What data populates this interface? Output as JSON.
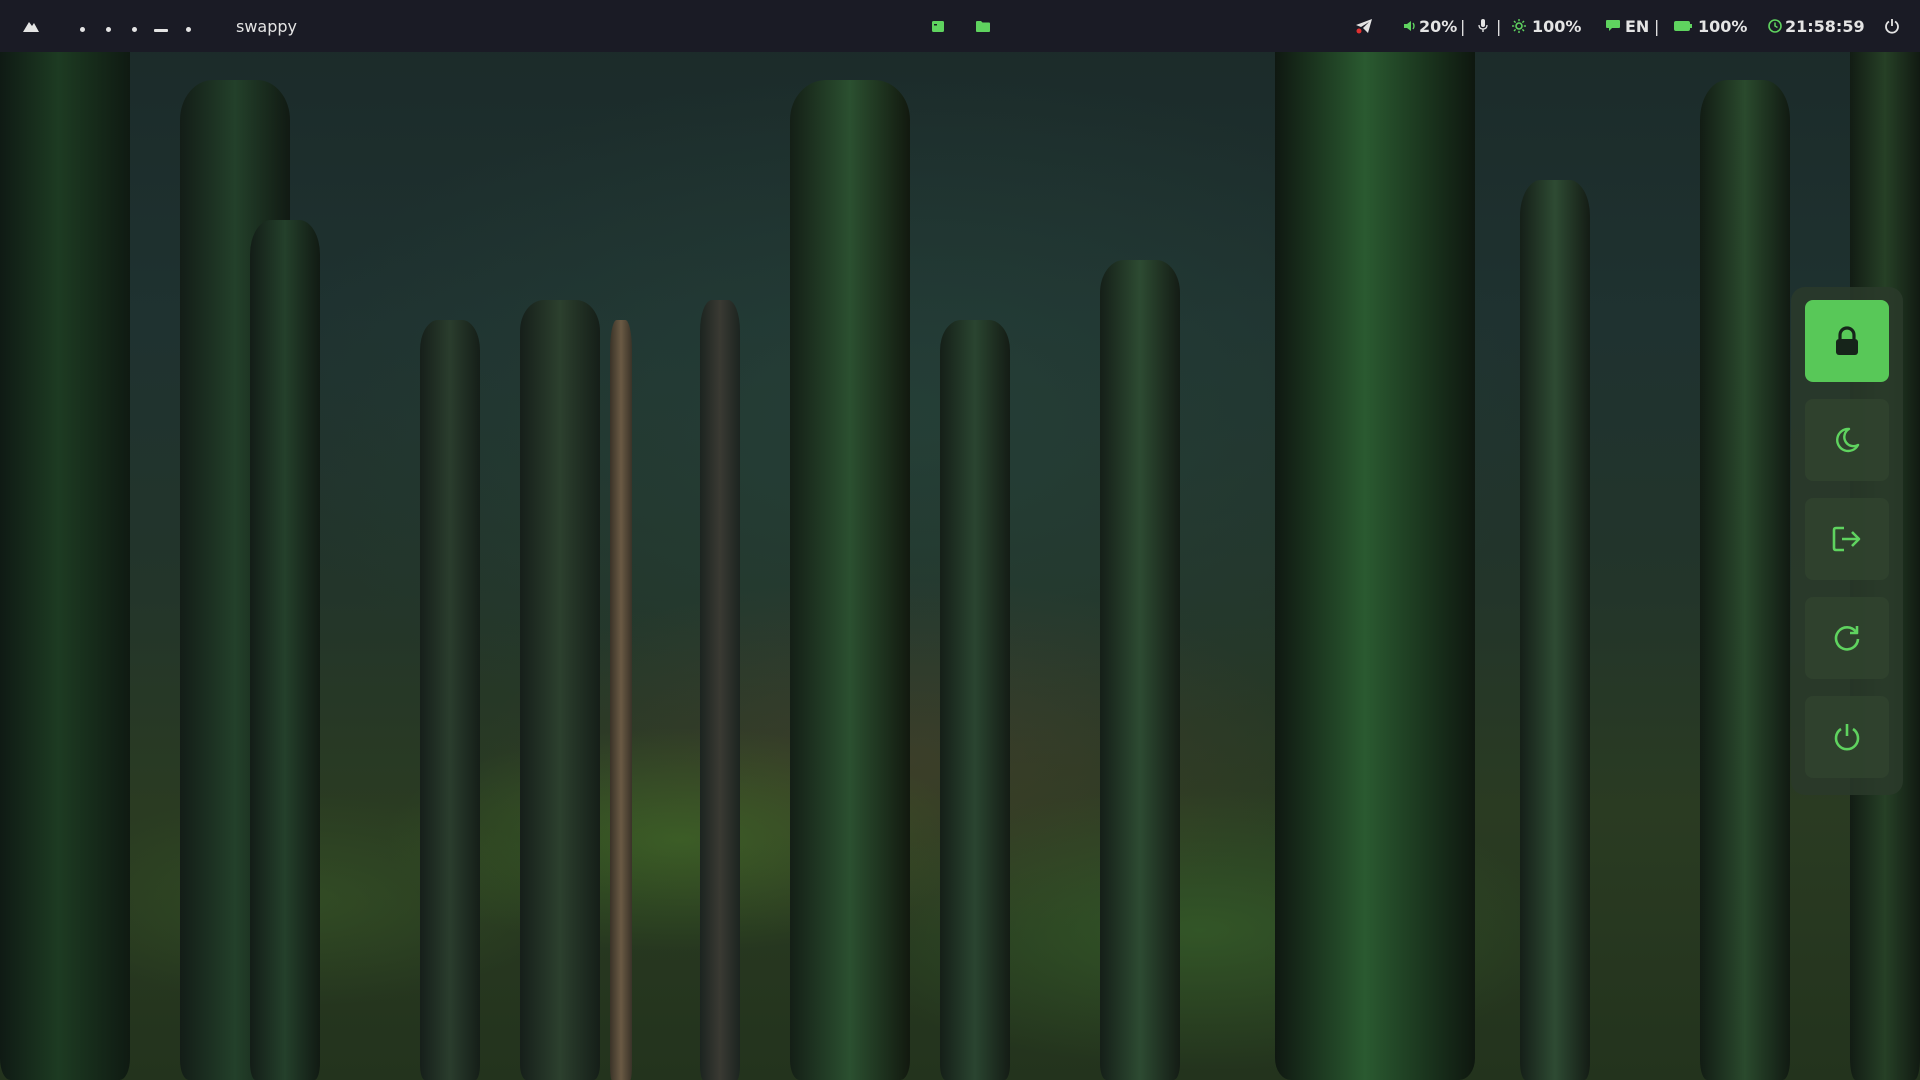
{
  "topbar": {
    "launcher_icon": "mountain-icon",
    "workspaces": [
      "dot",
      "dot",
      "dot",
      "dash",
      "dot"
    ],
    "window_title": "swappy",
    "center_icons": [
      "terminal-icon",
      "folder-icon"
    ],
    "tray_icon": "telegram-icon",
    "volume": {
      "icon": "volume-icon",
      "value": "20%"
    },
    "mic_icon": "microphone-icon",
    "brightness": {
      "icon": "sun-icon",
      "value": "100%"
    },
    "language": {
      "icon": "keyboard-icon",
      "value": "EN"
    },
    "battery": {
      "icon": "battery-icon",
      "value": "100%"
    },
    "clock": {
      "icon": "clock-icon",
      "value": "21:58:59"
    },
    "power_icon": "power-icon",
    "separator": "|"
  },
  "power_menu": {
    "buttons": [
      {
        "name": "lock",
        "icon": "lock-icon",
        "active": true
      },
      {
        "name": "suspend",
        "icon": "moon-icon",
        "active": false
      },
      {
        "name": "logout",
        "icon": "logout-icon",
        "active": false
      },
      {
        "name": "reboot",
        "icon": "reboot-icon",
        "active": false
      },
      {
        "name": "shutdown",
        "icon": "power-icon",
        "active": false
      }
    ]
  },
  "colors": {
    "bar_bg": "#1a1b25",
    "accent": "#5fd35f",
    "menu_bg": "#2a3a2a"
  }
}
